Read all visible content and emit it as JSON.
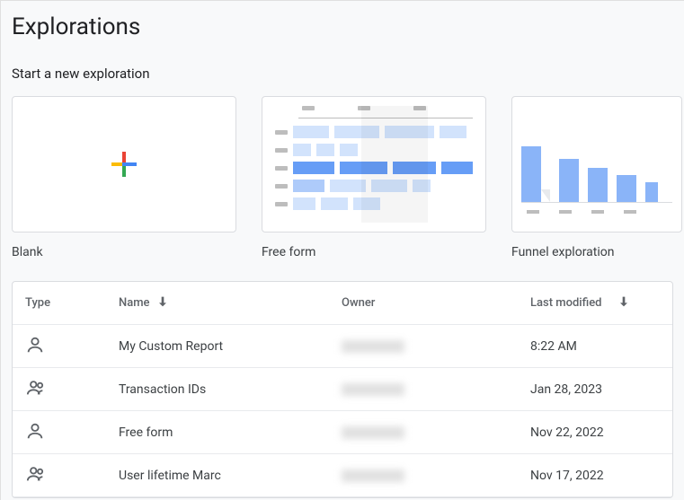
{
  "header": {
    "title": "Explorations"
  },
  "start_section": {
    "title": "Start a new exploration"
  },
  "templates": [
    {
      "id": "blank",
      "label": "Blank"
    },
    {
      "id": "freeform",
      "label": "Free form"
    },
    {
      "id": "funnel",
      "label": "Funnel exploration"
    }
  ],
  "table": {
    "columns": {
      "type": "Type",
      "name": "Name",
      "owner": "Owner",
      "last_modified": "Last modified"
    },
    "sort": {
      "column": "name",
      "direction": "desc"
    },
    "rows": [
      {
        "type": "person",
        "name": "My Custom Report",
        "last_modified": "8:22 AM"
      },
      {
        "type": "group",
        "name": "Transaction IDs",
        "last_modified": "Jan 28, 2023"
      },
      {
        "type": "person",
        "name": "Free form",
        "last_modified": "Nov 22, 2022"
      },
      {
        "type": "group",
        "name": "User lifetime Marc",
        "last_modified": "Nov 17, 2022"
      }
    ]
  }
}
